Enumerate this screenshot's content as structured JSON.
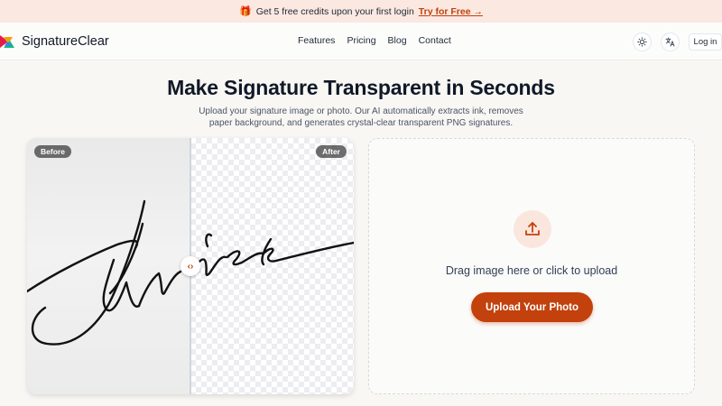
{
  "banner": {
    "gift_icon": "gift-icon",
    "text": "Get 5 free credits upon your first login",
    "cta": "Try for Free →"
  },
  "nav": {
    "brand": "SignatureClear",
    "links": [
      "Features",
      "Pricing",
      "Blog",
      "Contact"
    ],
    "theme_icon": "sun-icon",
    "language_icon": "translate-icon",
    "login": "Log in"
  },
  "hero": {
    "title": "Make Signature Transparent in Seconds",
    "subtitle": "Upload your signature image or photo. Our AI automatically extracts ink, removes paper background, and generates crystal-clear transparent PNG signatures."
  },
  "compare": {
    "before_label": "Before",
    "after_label": "After",
    "handle_icon": "arrows-left-right-icon"
  },
  "upload": {
    "icon": "upload-icon",
    "prompt": "Drag image here or click to upload",
    "button": "Upload Your Photo"
  },
  "colors": {
    "accent": "#c2410c",
    "banner_bg": "#fbe8e1",
    "page_bg": "#f8f7f4"
  }
}
